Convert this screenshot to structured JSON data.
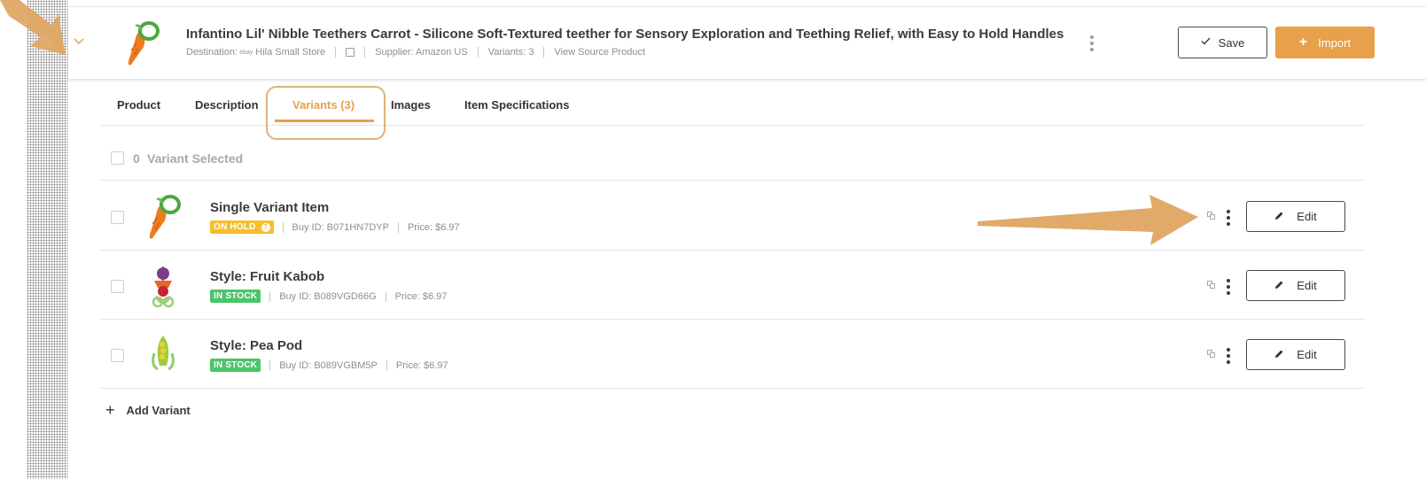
{
  "product": {
    "title": "Infantino Lil' Nibble Teethers Carrot - Silicone Soft-Textured teether for Sensory Exploration and Teething Relief, with Easy to Hold Handles",
    "destination_label": "Destination:",
    "destination_logo_text": "ebay",
    "destination_store": "Hila Small Store",
    "supplier": "Supplier: Amazon US",
    "variants_count": "Variants: 3",
    "view_source": "View Source Product",
    "save_label": "Save",
    "import_label": "Import"
  },
  "tabs": [
    {
      "label": "Product"
    },
    {
      "label": "Description"
    },
    {
      "label": "Variants (3)"
    },
    {
      "label": "Images"
    },
    {
      "label": "Item Specifications"
    }
  ],
  "selection": {
    "count": "0",
    "label": "Variant Selected"
  },
  "variants": [
    {
      "title": "Single Variant Item",
      "status": "ON HOLD",
      "buy_id": "Buy ID: B071HN7DYP",
      "price": "Price: $6.97",
      "edit_label": "Edit"
    },
    {
      "title": "Style: Fruit Kabob",
      "status": "IN STOCK",
      "buy_id": "Buy ID: B089VGD66G",
      "price": "Price: $6.97",
      "edit_label": "Edit"
    },
    {
      "title": "Style: Pea Pod",
      "status": "IN STOCK",
      "buy_id": "Buy ID: B089VGBM5P",
      "price": "Price: $6.97",
      "edit_label": "Edit"
    }
  ],
  "add_variant_label": "Add Variant",
  "colors": {
    "accent": "#e8a04a",
    "on_hold": "#f5c02e",
    "in_stock": "#4cc46a",
    "annotation": "#dfa561"
  },
  "icons": [
    "chevron-down-icon",
    "note-icon",
    "kebab-icon",
    "check-icon",
    "plus-icon",
    "copy-icon",
    "pencil-icon",
    "question-icon"
  ]
}
